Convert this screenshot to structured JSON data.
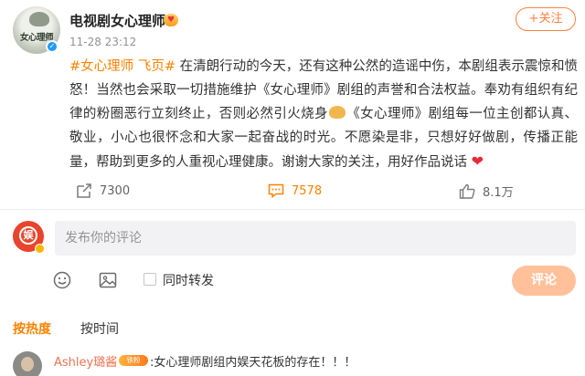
{
  "post": {
    "avatar_logo_text": "女心理师",
    "user_name": "电视剧女心理师",
    "time": "11-28 23:12",
    "follow_label": "+关注",
    "hashtag": "#女心理师 飞页#",
    "body_1": " 在清朗行动的今天，还有这种公然的造谣中伤，本剧组表示震惊和愤怒！当然也会采取一切措施维护《女心理师》剧组的声誉和合法权益。奉劝有组织有纪律的粉圈恶行立刻终止，否则必然引火烧身",
    "body_2": "《女心理师》剧组每一位主创都认真、敬业，小心也很怀念和大家一起奋战的时光。不愿染是非，只想好好做剧，传播正能量，帮助到更多的人重视心理健康。谢谢大家的关注，用好作品说话",
    "heart_emoji": "❤",
    "stats": {
      "reposts": "7300",
      "comments": "7578",
      "likes": "8.1万"
    }
  },
  "composer": {
    "avatar_text": "娱",
    "placeholder": "发布你的评论",
    "repost_label": "同时转发",
    "submit_label": "评论"
  },
  "sort_tabs": {
    "hot": "按热度",
    "time": "按时间"
  },
  "comments": [
    {
      "user": "Ashley璐酱",
      "badge": "铁粉",
      "text": ":女心理师剧组内娱天花板的存在！！！"
    }
  ],
  "colors": {
    "accent": "#ff8200",
    "follow": "#ff8140",
    "submit_disabled": "#ffc09a",
    "username_link": "#eb7350"
  },
  "icons": [
    "verified-icon",
    "vip-icon",
    "repost-icon",
    "comment-icon",
    "like-icon",
    "emoji-icon",
    "image-icon"
  ]
}
